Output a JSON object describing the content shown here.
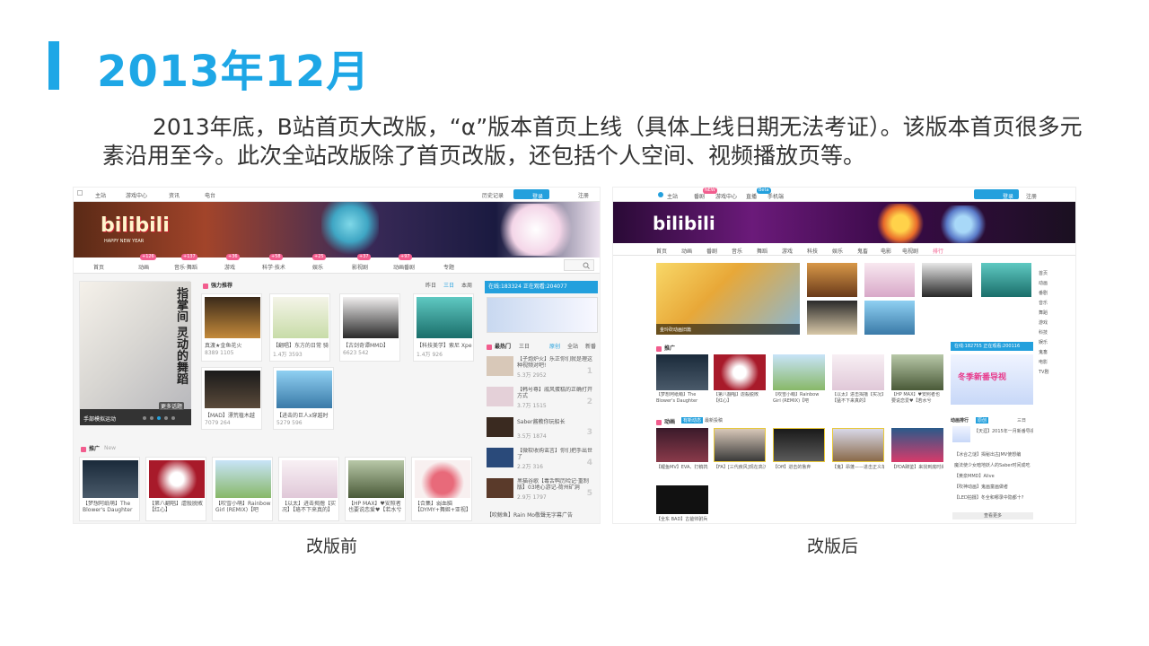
{
  "slide": {
    "title": "2013年12月",
    "body": "2013年底，B站首页大改版，“α”版本首页上线（具体上线日期无法考证）。该版本首页很多元素沿用至今。此次全站改版除了首页改版，还包括个人空间、视频播放页等。",
    "caption_before": "改版前",
    "caption_after": "改版后",
    "accent_color": "#1ea7e6"
  },
  "old_site": {
    "topbar": [
      "主站",
      "游戏中心",
      "资讯",
      "电台"
    ],
    "topbar_right": [
      "历史记录",
      "登录",
      "注册"
    ],
    "logo": "bilibili",
    "logo_sub": "HAPPY NEW YEAR",
    "nav": [
      "首页",
      "动画",
      "音乐·舞蹈",
      "游戏",
      "科学·技术",
      "娱乐",
      "影视剧",
      "动画番剧",
      "专题"
    ],
    "nav_badges": [
      "+126",
      "+137",
      "+36",
      "+58",
      "+25",
      "+37",
      "+97"
    ],
    "slider_caption": "手部模拟运动",
    "slider_more": "更多话题",
    "slider_text": "指掌间 灵动的舞蹈",
    "rec_title": "强力推荐",
    "rec_tabs": [
      "昨日",
      "三日",
      "本周"
    ],
    "rec_items": [
      {
        "title": "真渡★金鱼花火",
        "stats": "8389  1105"
      },
      {
        "title": "【翻唱】东方的日常 骑",
        "stats": "1.4万  3593"
      },
      {
        "title": "【古剑奇谭MMD】",
        "stats": "6623  542"
      },
      {
        "title": "【科技美学】索尼 Xpe",
        "stats": "1.4万  926"
      },
      {
        "title": "【MAD】漂荒植木越",
        "stats": "7079  264"
      },
      {
        "title": "【进击的巨人x穿越时",
        "stats": "5279  596"
      }
    ],
    "live_bar": "在线:183324  正在观看:204077",
    "hot_title": "最热门",
    "hot_tabs": [
      "三日",
      "原创",
      "全站",
      "新番"
    ],
    "hot_items": [
      {
        "title": "【子炮炉火】乐正你们就是理这种视频对吧!",
        "stats": "5.3万  2952",
        "rank": "1"
      },
      {
        "title": "【韩号尊】戚风蛋糕的正确打开方式",
        "stats": "3.7万  1515",
        "rank": "2"
      },
      {
        "title": "Saber酱教你玩船长",
        "stats": "3.5万  1874",
        "rank": "3"
      },
      {
        "title": "【微软收购谣言】你们把手出世了",
        "stats": "2.2万  316",
        "rank": "4"
      },
      {
        "title": "黑猫谷歌【毒舌鸭历险记·重制版】03地心游记-荷州矿洞",
        "stats": "2.9万  1797",
        "rank": "5"
      },
      {
        "title": "【吹鲸鱼】Rain Mo敬聲无字幕广告",
        "stats": "",
        "rank": ""
      }
    ],
    "promo_title": "推广",
    "promo_sub": "New",
    "promo_items": [
      "【梦想阿纸萌】The Blower's Daughter",
      "【第八翻唱】虐殺脱敗【红心】",
      "【吹雪小萌】Rainbow Girl (REMIX)【吧",
      "【以太】进击揭撸【实况】【珞不下来真的】",
      "【HP MAX】♥安照者也要说恋爱♥【若水兮",
      "【合集】弱血脑【DYMY+舞姬+亚视】"
    ]
  },
  "new_site": {
    "topbar": [
      "主站",
      "番剧",
      "游戏中心",
      "直播",
      "手机端"
    ],
    "topbar_badges": [
      "NEW",
      "Beta"
    ],
    "topbar_right": [
      "登录",
      "注册"
    ],
    "logo": "bilibili",
    "nav": [
      "首页",
      "动画",
      "番剧",
      "音乐",
      "舞蹈",
      "游戏",
      "科技",
      "娱乐",
      "鬼畜",
      "电影",
      "电视剧",
      "排行"
    ],
    "slider_caption": "金玲砍动画旧篇",
    "promo_title": "推广",
    "live_bar": "在线:182755  正在观看:200116",
    "promo_items": [
      "【梦想阿纸萌】The Blower's Daughter",
      "【第八翻唱】虐殺脱敗【红心】",
      "【吹雪小萌】Rainbow Girl (REMIX)【吧",
      "【以太】进击揭撸【实况】【猛不下来真的】",
      "【HP MAX】♥安照者也要说恋爱♥【若水兮"
    ],
    "promo_banner_text": "冬季新番导视",
    "anime_title": "动画",
    "anime_tabs": [
      "有新动态",
      "最新投稿"
    ],
    "anime_items": [
      "【鲤鱼MV】EVA、打鹌鹑舟",
      "【FA】[三代疾风]现在高沉",
      "【Off】进击的鲁弃",
      "【鬼】昂蓬——进击正义单",
      "【PDA蹄鉴】来找到底时尚",
      "【全东 BAD】古爸帅驸兵"
    ],
    "rank_title": "动画排行",
    "rank_tabs": [
      "原创",
      "三日"
    ],
    "rank_items": [
      "【天涯】2015年一月新番导视盘点",
      "【冰合之谜】揭秘出古JMV使想编",
      "魔法使少女暗地妖人的Saber时间成吃",
      "【黄泉MMD】Alive",
      "【吹神动画】鬼画童画做者",
      "【LED拍摄】冬全和哪录中隐都十?"
    ],
    "side_links": [
      "首页",
      "动画",
      "番剧",
      "音乐",
      "舞蹈",
      "游戏",
      "科技",
      "娱乐",
      "鬼畜",
      "电影",
      "TV剧"
    ],
    "more": "查看更多"
  }
}
